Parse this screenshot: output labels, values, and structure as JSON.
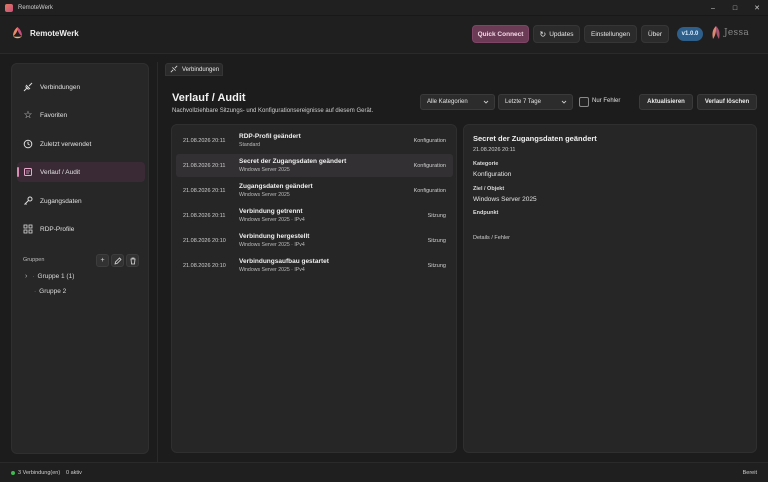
{
  "window": {
    "title": "RemoteWerk"
  },
  "header": {
    "app_name": "RemoteWerk",
    "quick_connect": "Quick Connect",
    "updates": "Updates",
    "settings": "Einstellungen",
    "about": "Über",
    "version": "v1.0.0",
    "partner_logo": "Jessa"
  },
  "sidebar": {
    "items": [
      {
        "label": "Verbindungen",
        "icon": "plug-icon"
      },
      {
        "label": "Favoriten",
        "icon": "star-icon"
      },
      {
        "label": "Zuletzt verwendet",
        "icon": "history-icon"
      },
      {
        "label": "Verlauf / Audit",
        "icon": "audit-icon",
        "active": true
      },
      {
        "label": "Zugangsdaten",
        "icon": "key-icon"
      },
      {
        "label": "RDP-Profile",
        "icon": "grid-icon"
      }
    ],
    "groups_label": "Gruppen",
    "groups": [
      {
        "label": "Gruppe 1 (1)"
      },
      {
        "label": "Gruppe 2"
      }
    ]
  },
  "tab": {
    "label": "Verbindungen"
  },
  "page": {
    "title": "Verlauf / Audit",
    "subtitle": "Nachvollziehbare Sitzungs- und Konfigurationsereignisse auf diesem Gerät."
  },
  "filters": {
    "category": "Alle Kategorien",
    "range": "Letzte 7 Tage",
    "errors_only": "Nur Fehler",
    "refresh": "Aktualisieren",
    "clear": "Verlauf löschen"
  },
  "events": [
    {
      "time": "21.08.2026 20:11",
      "title": "RDP-Profil geändert",
      "subtitle": "Standard",
      "category": "Konfiguration"
    },
    {
      "time": "21.08.2026 20:11",
      "title": "Secret der Zugangsdaten geändert",
      "subtitle": "Windows Server 2025",
      "category": "Konfiguration",
      "selected": true
    },
    {
      "time": "21.08.2026 20:11",
      "title": "Zugangsdaten geändert",
      "subtitle": "Windows Server 2025",
      "category": "Konfiguration"
    },
    {
      "time": "21.08.2026 20:11",
      "title": "Verbindung getrennt",
      "subtitle": "Windows Server 2025 · IPv4",
      "category": "Sitzung"
    },
    {
      "time": "21.08.2026 20:10",
      "title": "Verbindung hergestellt",
      "subtitle": "Windows Server 2025 · IPv4",
      "category": "Sitzung"
    },
    {
      "time": "21.08.2026 20:10",
      "title": "Verbindungsaufbau gestartet",
      "subtitle": "Windows Server 2025 · IPv4",
      "category": "Sitzung"
    }
  ],
  "detail": {
    "title": "Secret der Zugangsdaten geändert",
    "time": "21.08.2026 20:11",
    "category_label": "Kategorie",
    "category_value": "Konfiguration",
    "target_label": "Ziel / Objekt",
    "target_value": "Windows Server 2025",
    "endpoint_label": "Endpunkt",
    "errors_label": "Details / Fehler"
  },
  "status": {
    "connections": "3 Verbindung(en)",
    "active": "0 aktiv",
    "state": "Bereit"
  },
  "colors": {
    "accent": "#6b3a55",
    "version_badge": "#2e5f8a",
    "status_ok": "#3fb950"
  }
}
